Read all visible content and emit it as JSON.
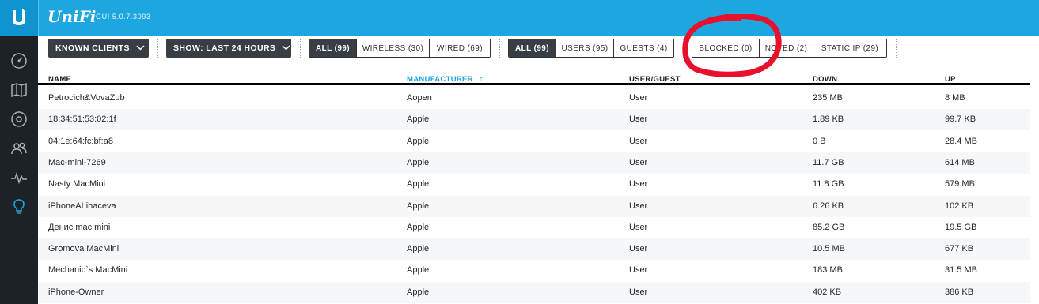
{
  "header": {
    "brand": "UniFi",
    "version": "GUI 5.0.7.3093",
    "logo_icon": "ubiquiti-u-logo",
    "color": "#1ea6e0"
  },
  "sidebar": {
    "items": [
      {
        "icon": "dashboard-gauge-icon"
      },
      {
        "icon": "map-icon"
      },
      {
        "icon": "devices-icon"
      },
      {
        "icon": "clients-icon"
      },
      {
        "icon": "statistics-icon"
      },
      {
        "icon": "insights-bulb-icon",
        "active": true,
        "active_color": "#1ea6e0"
      }
    ]
  },
  "toolbar": {
    "client_filter": "KNOWN CLIENTS",
    "time_filter": "SHOW: LAST 24 HOURS",
    "connection_tabs": [
      "ALL (99)",
      "WIRELESS (30)",
      "WIRED (69)"
    ],
    "type_tabs": [
      "ALL (99)",
      "USERS (95)",
      "GUESTS (4)"
    ],
    "status_tabs": [
      "BLOCKED (0)",
      "NOTED (2)",
      "STATIC IP (29)"
    ]
  },
  "table": {
    "columns": [
      "NAME",
      "MANUFACTURER",
      "USER/GUEST",
      "DOWN",
      "UP"
    ],
    "sorted_column": "MANUFACTURER",
    "sort_arrow": "↑",
    "rows": [
      [
        "Petrocich&VovaZub",
        "Aopen",
        "User",
        "235 MB",
        "8 MB"
      ],
      [
        "18:34:51:53:02:1f",
        "Apple",
        "User",
        "1.89 KB",
        "99.7 KB"
      ],
      [
        "04:1e:64:fc:bf:a8",
        "Apple",
        "User",
        "0 B",
        "28.4 MB"
      ],
      [
        "Mac-mini-7269",
        "Apple",
        "User",
        "11.7 GB",
        "614 MB"
      ],
      [
        "Nasty MacMini",
        "Apple",
        "User",
        "11.8 GB",
        "579 MB"
      ],
      [
        "iPhoneALihaceva",
        "Apple",
        "User",
        "6.26 KB",
        "102 KB"
      ],
      [
        "Денис mac mini",
        "Apple",
        "User",
        "85.2 GB",
        "19.5 GB"
      ],
      [
        "Gromova MacMini",
        "Apple",
        "User",
        "10.5 MB",
        "677 KB"
      ],
      [
        "Mechanic`s MacMini",
        "Apple",
        "User",
        "183 MB",
        "31.5 MB"
      ],
      [
        "iPhone-Owner",
        "Apple",
        "User",
        "402 KB",
        "386 KB"
      ]
    ]
  },
  "annotation": {
    "shape": "red-hand-drawn-circle",
    "color": "#e8102a"
  }
}
